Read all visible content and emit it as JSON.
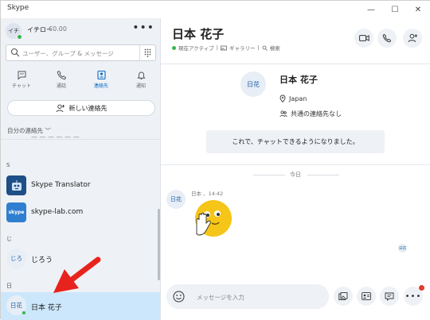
{
  "window": {
    "title": "Skype",
    "minimize": "—",
    "maximize": "☐",
    "close": "✕"
  },
  "profile": {
    "initials": "イチ",
    "name": "イチロー",
    "credit": "€0.00",
    "more": "•••"
  },
  "search": {
    "placeholder": "ユーザー、グループ & メッセージ"
  },
  "nav": {
    "chats": "チャット",
    "calls": "通話",
    "contacts": "連絡先",
    "notifications": "通知"
  },
  "new_contact": {
    "label": "新しい連絡先"
  },
  "my_contacts": {
    "label": "自分の連絡先 ﹀"
  },
  "contacts": {
    "partial_name": "— — — — — —",
    "section_s": "S",
    "translator": {
      "name": "Skype Translator"
    },
    "lab": {
      "name": "skype-lab.com",
      "badge": "skype"
    },
    "section_ji": "じ",
    "jirou": {
      "initials": "じろ",
      "name": "じろう"
    },
    "section_hi": "日",
    "hanako": {
      "initials": "日花",
      "name": "日本 花子"
    }
  },
  "conversation": {
    "title": "日本 花子",
    "status": "現在アクティブ",
    "gallery": "ギャラリー",
    "search": "検索",
    "profile": {
      "initials": "日花",
      "name": "日本 花子",
      "location": "Japan",
      "common": "共通の連絡先なし"
    },
    "info": "これで、チャットできるようになりました。",
    "today": "今日",
    "message": {
      "initials": "日花",
      "meta": "日本 、14:42"
    },
    "read_receipt": "日花"
  },
  "composer": {
    "placeholder": "メッセージを入力"
  },
  "colors": {
    "accent": "#0a6cc4",
    "online": "#3cb44b",
    "selected": "#cce7fb",
    "arrow": "#e8231e"
  }
}
